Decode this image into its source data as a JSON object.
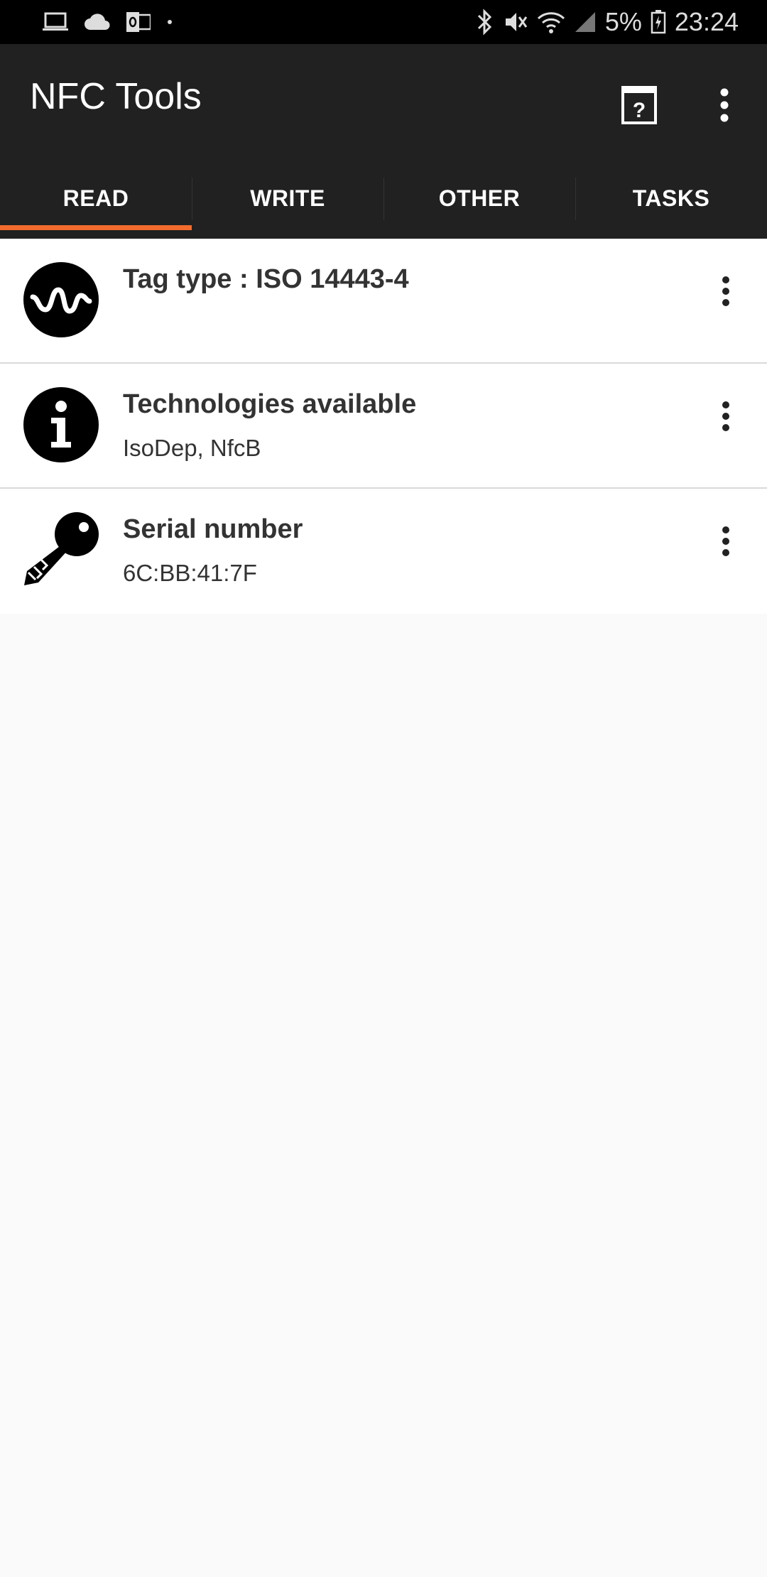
{
  "status_bar": {
    "left_icons": [
      "laptop-icon",
      "cloud-icon",
      "outlook-icon",
      "dot-icon"
    ],
    "right_icons": [
      "bluetooth-icon",
      "mute-icon",
      "wifi-icon",
      "signal-icon",
      "battery-icon"
    ],
    "battery": "5%",
    "time": "23:24"
  },
  "app": {
    "title": "NFC Tools",
    "actions": [
      "help-icon",
      "overflow-menu-icon"
    ]
  },
  "tabs": [
    {
      "label": "READ",
      "active": true
    },
    {
      "label": "WRITE",
      "active": false
    },
    {
      "label": "OTHER",
      "active": false
    },
    {
      "label": "TASKS",
      "active": false
    }
  ],
  "colors": {
    "accent": "#f26b2d",
    "appbar": "#212121",
    "background": "#fafafa"
  },
  "items": [
    {
      "icon": "wave-icon",
      "title": "Tag type : ISO 14443-4",
      "subtitle": ""
    },
    {
      "icon": "info-icon",
      "title": "Technologies available",
      "subtitle": "IsoDep, NfcB"
    },
    {
      "icon": "key-icon",
      "title": "Serial number",
      "subtitle": "6C:BB:41:7F"
    }
  ]
}
